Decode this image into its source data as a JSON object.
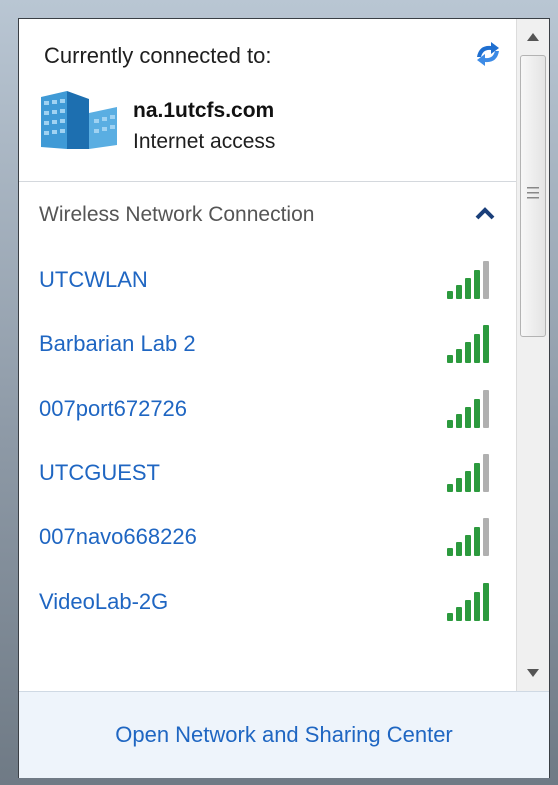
{
  "connected": {
    "label": "Currently connected to:",
    "network_name": "na.1utcfs.com",
    "status": "Internet access"
  },
  "section": {
    "title": "Wireless Network Connection"
  },
  "networks": [
    {
      "ssid": "UTCWLAN",
      "signal_bars": 4
    },
    {
      "ssid": "Barbarian Lab 2",
      "signal_bars": 5
    },
    {
      "ssid": "007port672726",
      "signal_bars": 4
    },
    {
      "ssid": "UTCGUEST",
      "signal_bars": 4
    },
    {
      "ssid": "007navo668226",
      "signal_bars": 4
    },
    {
      "ssid": "VideoLab-2G",
      "signal_bars": 5
    }
  ],
  "footer": {
    "link": "Open Network and Sharing Center"
  },
  "colors": {
    "link": "#1f66c2",
    "signal_on": "#2c9a3e",
    "signal_off": "#b0b0b0"
  },
  "icons": {
    "refresh": "refresh-arrows-icon",
    "building": "network-building-icon",
    "collapse": "chevron-up-icon",
    "signal": "signal-strength-icon"
  }
}
